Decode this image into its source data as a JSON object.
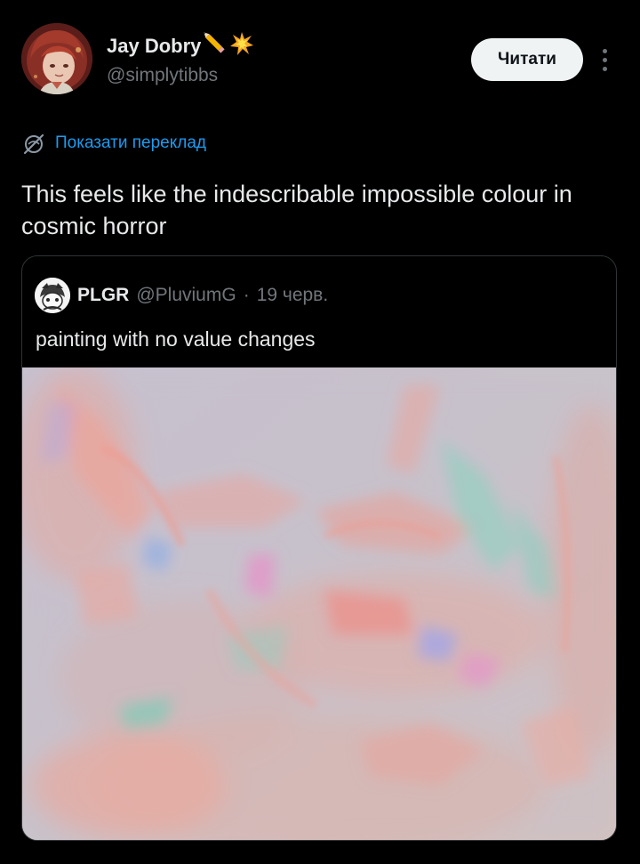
{
  "author": {
    "name": "Jay Dobry",
    "name_emoji": "✏️💥",
    "handle": "@simplytibbs",
    "avatar_icon": "avatar-anime-red-hair"
  },
  "actions": {
    "follow_label": "Читати",
    "more_icon": "more-dots-vertical-icon"
  },
  "translate": {
    "label": "Показати переклад",
    "icon": "globe-slash-icon"
  },
  "tweet": {
    "text": "This feels like the indescribable impossible colour in cosmic horror"
  },
  "quote": {
    "author_name": "PLGR",
    "author_handle": "@PluviumG",
    "separator": "·",
    "date": "19 черв.",
    "text": "painting with no value changes",
    "media_description_icon": "pastel-painting-image"
  },
  "colors": {
    "background": "#000000",
    "text_primary": "#e7e9ea",
    "text_secondary": "#71767b",
    "link": "#1d9bf0",
    "button_bg": "#eff3f4",
    "border": "#2f3336"
  }
}
